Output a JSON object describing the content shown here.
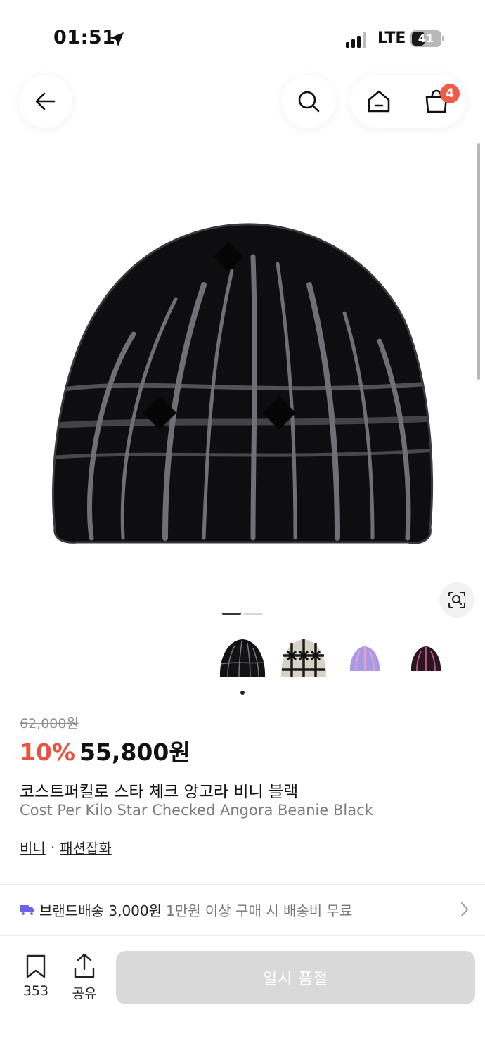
{
  "status_bar": {
    "time": "01:51",
    "network": "LTE",
    "battery": "41",
    "icons": [
      "location-arrow-icon",
      "signal-bars-icon",
      "battery-icon"
    ]
  },
  "header": {
    "icons": [
      "back-arrow-icon",
      "search-icon",
      "home-icon",
      "cart-icon"
    ],
    "cart_count": "4",
    "badge_color": "#f25a4a"
  },
  "gallery": {
    "image_count": 2,
    "active_index": 0,
    "thumbnails": [
      {
        "name": "black-star-beanie",
        "color": "#111111"
      },
      {
        "name": "beige-star-beanie",
        "color": "#d8d2c6"
      },
      {
        "name": "lavender-beanie",
        "color": "#a79be8"
      },
      {
        "name": "burgundy-beanie",
        "color": "#2a1520"
      }
    ],
    "selected_thumbnail": 0
  },
  "product": {
    "original_price": "62,000원",
    "discount": "10%",
    "price": "55,800원",
    "name_ko": "코스트퍼킬로 스타 체크 앙고라 비니 블랙",
    "name_en": "Cost Per Kilo Star Checked Angora Beanie Black",
    "category": "비니",
    "separator": "·",
    "subcategory": "패션잡화",
    "discount_color": "#e8533f"
  },
  "shipping": {
    "main": "브랜드배송 3,000원",
    "sub": "1만원 이상 구매 시 배송비 무료",
    "icon_color": "#6c63e8"
  },
  "bottom_bar": {
    "bookmark_count": "353",
    "share_label": "공유",
    "cta_label": "일시 품절",
    "cta_color": "#d9d9d9"
  }
}
